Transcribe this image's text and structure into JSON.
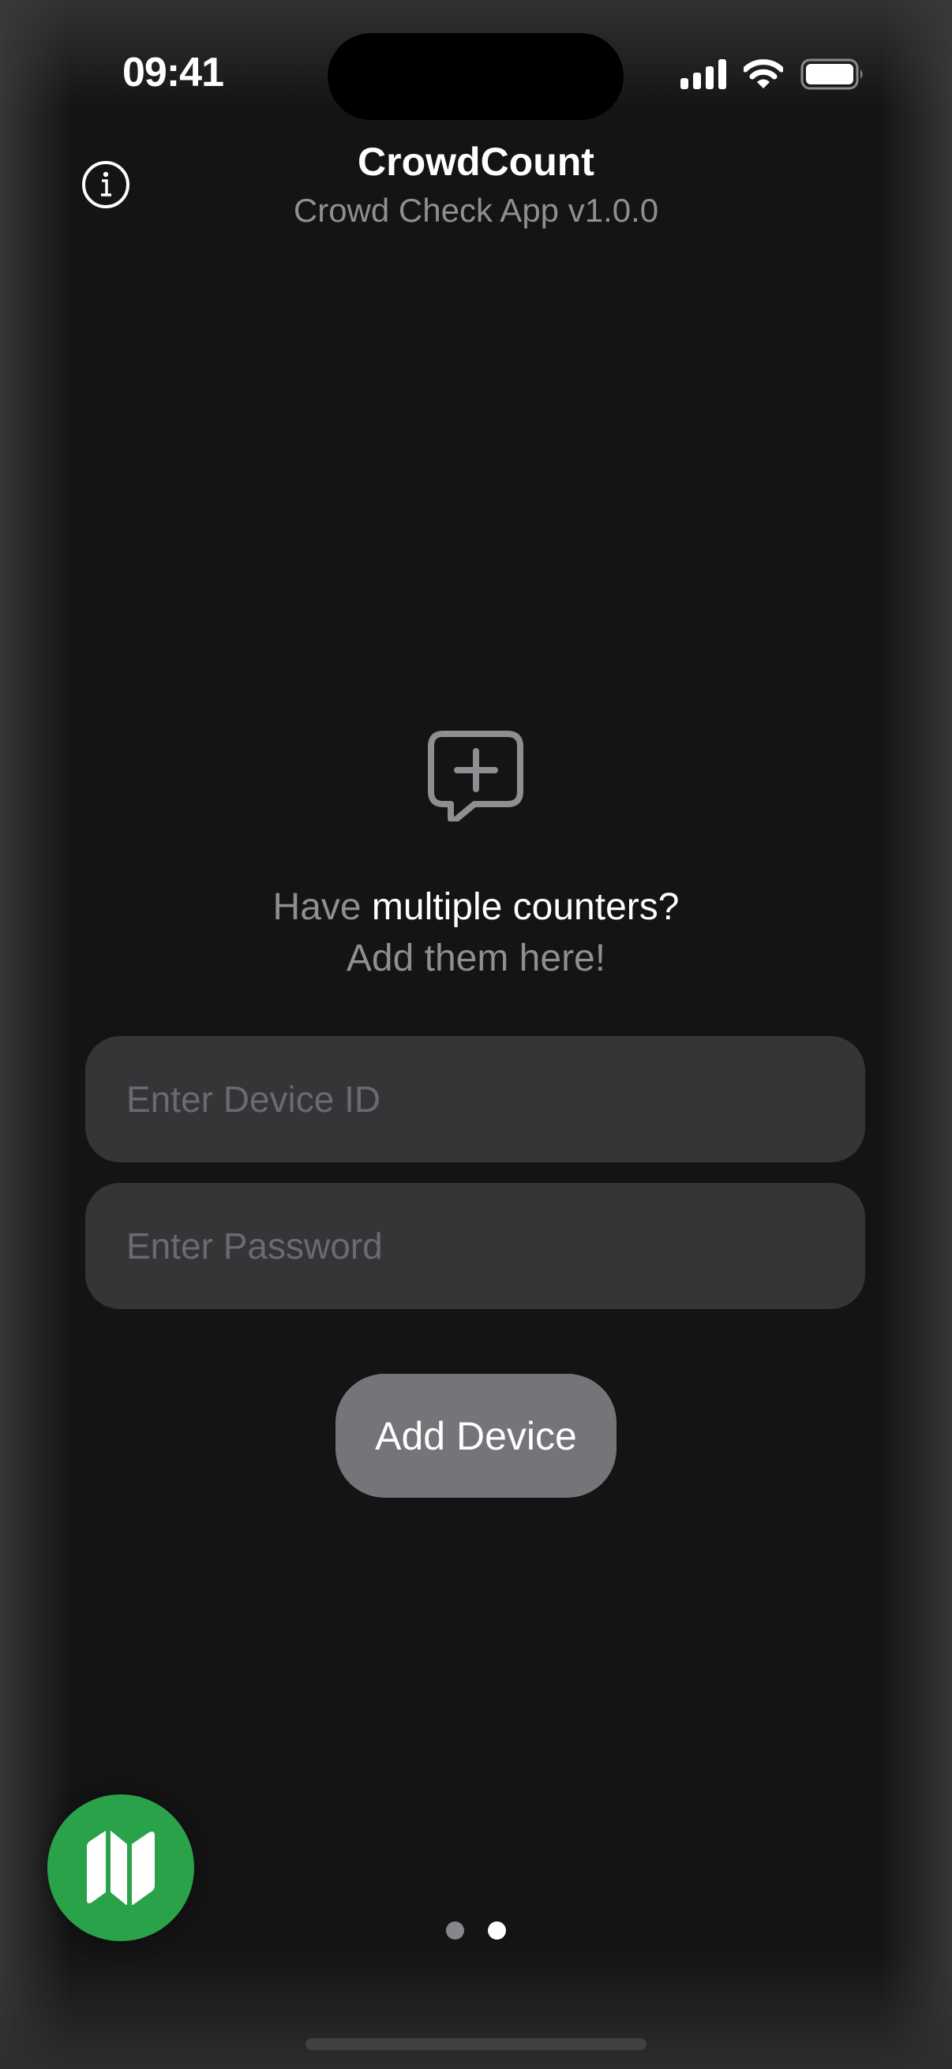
{
  "status_bar": {
    "time": "09:41",
    "icons": [
      "cellular-signal-icon",
      "wifi-icon",
      "battery-icon"
    ]
  },
  "header": {
    "info_icon": "info-circle-icon",
    "title": "CrowdCount",
    "subtitle": "Crowd Check App v1.0.0"
  },
  "empty_state": {
    "icon": "message-plus-icon",
    "line1_muted": "Have ",
    "line1_emphasis": "multiple counters?",
    "line2": "Add them here!"
  },
  "form": {
    "device_id": {
      "value": "",
      "placeholder": "Enter Device ID"
    },
    "password": {
      "value": "",
      "placeholder": "Enter Password"
    },
    "submit_label": "Add Device"
  },
  "map_button": {
    "icon": "map-icon"
  },
  "pager": {
    "total_pages": 2,
    "current_page": 2
  },
  "colors": {
    "background": "#141414",
    "accent_green": "#2aa24a",
    "field_bg": "#353537",
    "button_bg": "#757579",
    "muted_text": "#8e8e93"
  }
}
